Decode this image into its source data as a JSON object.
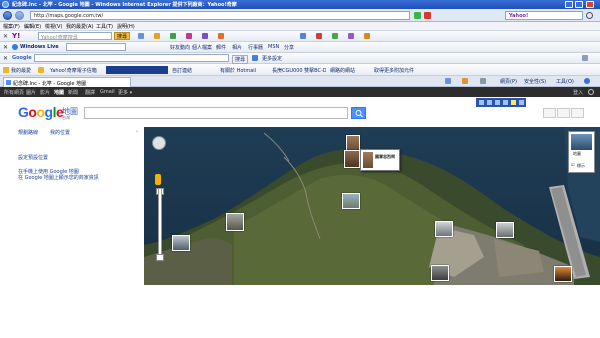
{
  "window": {
    "title": "紀念碑.lnc - 北竿 - Google 地圖 - Windows Internet Explorer 提供下列廠商：Yahoo!奇摩"
  },
  "address_bar": {
    "url": "http://maps.google.com.tw/",
    "yahoo_search_placeholder": "Yahoo!"
  },
  "menu": {
    "items": [
      "檔案(F)",
      "編輯(E)",
      "檢視(V)",
      "我的最愛(A)",
      "工具(T)",
      "說明(H)"
    ]
  },
  "toolbar_yahoo": {
    "search_placeholder": "Yahoo!奇摩搜尋",
    "search_button": "搜尋",
    "items": [
      "信箱",
      "拍賣",
      "新聞",
      "知識+",
      "雅虎",
      "部落格"
    ]
  },
  "toolbar_live": {
    "brand": "Windows Live",
    "items": [
      "好友動向",
      "個人檔案",
      "郵件",
      "相片",
      "行事曆",
      "MSN",
      "分享"
    ]
  },
  "toolbar_google": {
    "brand": "Google",
    "search_button": "搜尋",
    "more_label": "更多設定"
  },
  "favorites_bar": {
    "title": "我的最愛",
    "items": [
      "Yahoo!奇摩電子信箱",
      "自訂連結",
      "有關於 Hotmail",
      "長庚CGU000 雙擊BC-D3...",
      "網路的網站",
      "取得更多附加元件"
    ],
    "right_items": [
      "網頁(P)",
      "安全性(S)",
      "工具(O)"
    ]
  },
  "tab": {
    "label": "紀念碑.lnc - 北竿 - Google 地圖"
  },
  "google_bar": {
    "items": [
      "所有網頁",
      "圖片",
      "影片",
      "地圖",
      "新聞",
      "翻譯",
      "Gmail",
      "更多 ▾"
    ],
    "signin": "登入"
  },
  "google_header": {
    "logo_text": "Google",
    "product_name": "地圖",
    "region": "台灣"
  },
  "left_panel": {
    "links_top": [
      "規劃路線",
      "我的位置"
    ],
    "links": [
      "設定預設位置",
      "在手機上使用 Google 地圖",
      "在 Google 地圖上顯示您的商家資訊"
    ]
  },
  "map": {
    "popup_label": "國軍忠烈祠",
    "map_type_label": "地圖",
    "checkbox_label": "標示",
    "checkbox_checked": true
  },
  "colors": {
    "ie_blue": "#1f4fb8",
    "google_blue": "#4d90fe",
    "link_blue": "#1a3f9a",
    "gbar": "#2d2d2d"
  }
}
